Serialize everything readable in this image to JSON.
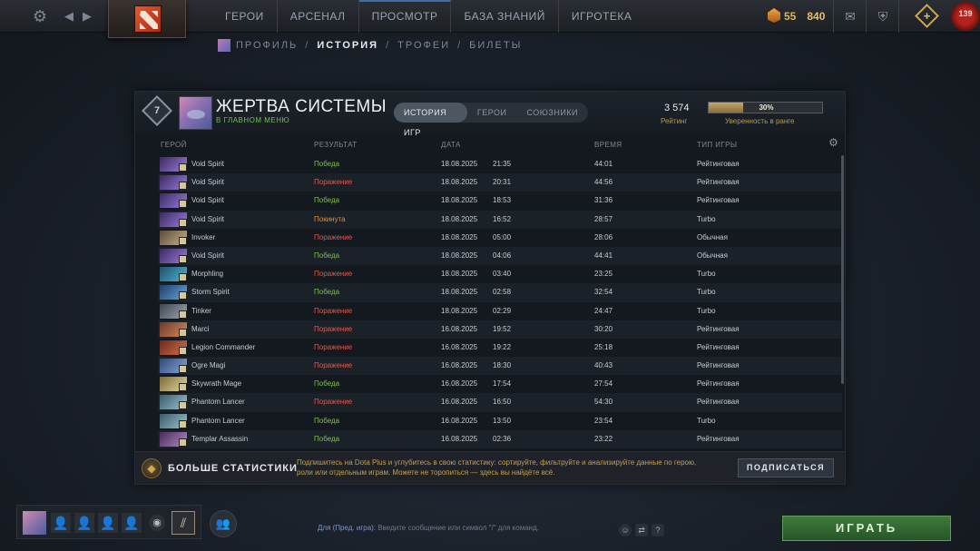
{
  "topbar": {
    "nav": [
      "ГЕРОИ",
      "АРСЕНАЛ",
      "ПРОСМОТР",
      "БАЗА ЗНАНИЙ",
      "ИГРОТЕКА"
    ],
    "gold": "55",
    "shards": "840",
    "notification_count": "139"
  },
  "subnav": {
    "items": [
      "ПРОФИЛЬ",
      "ИСТОРИЯ",
      "ТРОФЕИ",
      "БИЛЕТЫ"
    ],
    "separator": "/"
  },
  "profile": {
    "rank": "7",
    "name": "ЖЕРТВА СИСТЕМЫ",
    "status": "В ГЛАВНОМ МЕНЮ",
    "tabs": [
      "ИСТОРИЯ ИГР",
      "ГЕРОИ",
      "СОЮЗНИКИ"
    ],
    "rating_value": "3 574",
    "rating_label": "Рейтинг",
    "confidence_percent": 30,
    "confidence_text": "30%",
    "confidence_label": "Уверенность в ранге"
  },
  "columns": {
    "hero": "ГЕРОЙ",
    "result": "РЕЗУЛЬТАТ",
    "date": "ДАТА",
    "duration": "ВРЕМЯ",
    "mode": "ТИП ИГРЫ"
  },
  "colors": {
    "win": "#7ec04f",
    "loss": "#e25a48",
    "abandon": "#e48a3a"
  },
  "matches": [
    {
      "hero": "Void Spirit",
      "result": "Победа",
      "status": "win",
      "date": "18.08.2025",
      "time": "21:35",
      "duration": "44:01",
      "mode": "Рейтинговая",
      "portrait": [
        "#3b2a63",
        "#9b7ad8"
      ]
    },
    {
      "hero": "Void Spirit",
      "result": "Поражение",
      "status": "loss",
      "date": "18.08.2025",
      "time": "20:31",
      "duration": "44:56",
      "mode": "Рейтинговая",
      "portrait": [
        "#3b2a63",
        "#9b7ad8"
      ]
    },
    {
      "hero": "Void Spirit",
      "result": "Победа",
      "status": "win",
      "date": "18.08.2025",
      "time": "18:53",
      "duration": "31:36",
      "mode": "Рейтинговая",
      "portrait": [
        "#3b2a63",
        "#9b7ad8"
      ]
    },
    {
      "hero": "Void Spirit",
      "result": "Покинута",
      "status": "abandon",
      "date": "18.08.2025",
      "time": "16:52",
      "duration": "28:57",
      "mode": "Turbo",
      "portrait": [
        "#3b2a63",
        "#9b7ad8"
      ]
    },
    {
      "hero": "Invoker",
      "result": "Поражение",
      "status": "loss",
      "date": "18.08.2025",
      "time": "05:00",
      "duration": "28:06",
      "mode": "Обычная",
      "portrait": [
        "#5b4a3a",
        "#c9b08a"
      ]
    },
    {
      "hero": "Void Spirit",
      "result": "Победа",
      "status": "win",
      "date": "18.08.2025",
      "time": "04:06",
      "duration": "44:41",
      "mode": "Обычная",
      "portrait": [
        "#3b2a63",
        "#9b7ad8"
      ]
    },
    {
      "hero": "Morphling",
      "result": "Поражение",
      "status": "loss",
      "date": "18.08.2025",
      "time": "03:40",
      "duration": "23:25",
      "mode": "Turbo",
      "portrait": [
        "#1f4e6b",
        "#52b6d4"
      ]
    },
    {
      "hero": "Storm Spirit",
      "result": "Победа",
      "status": "win",
      "date": "18.08.2025",
      "time": "02:58",
      "duration": "32:54",
      "mode": "Turbo",
      "portrait": [
        "#1e3f66",
        "#62a8e0"
      ]
    },
    {
      "hero": "Tinker",
      "result": "Поражение",
      "status": "loss",
      "date": "18.08.2025",
      "time": "02:29",
      "duration": "24:47",
      "mode": "Turbo",
      "portrait": [
        "#3c4652",
        "#a0a8b0"
      ]
    },
    {
      "hero": "Marci",
      "result": "Поражение",
      "status": "loss",
      "date": "16.08.2025",
      "time": "19:52",
      "duration": "30:20",
      "mode": "Рейтинговая",
      "portrait": [
        "#6a3a2a",
        "#d88a5a"
      ]
    },
    {
      "hero": "Legion Commander",
      "result": "Поражение",
      "status": "loss",
      "date": "16.08.2025",
      "time": "19:22",
      "duration": "25:18",
      "mode": "Рейтинговая",
      "portrait": [
        "#6b2a1c",
        "#d4704a"
      ]
    },
    {
      "hero": "Ogre Magi",
      "result": "Поражение",
      "status": "loss",
      "date": "16.08.2025",
      "time": "18:30",
      "duration": "40:43",
      "mode": "Рейтинговая",
      "portrait": [
        "#2e4a7a",
        "#8aa6d8"
      ]
    },
    {
      "hero": "Skywrath Mage",
      "result": "Победа",
      "status": "win",
      "date": "16.08.2025",
      "time": "17:54",
      "duration": "27:54",
      "mode": "Рейтинговая",
      "portrait": [
        "#7a6a3a",
        "#e8d89a"
      ]
    },
    {
      "hero": "Phantom Lancer",
      "result": "Поражение",
      "status": "loss",
      "date": "16.08.2025",
      "time": "16:50",
      "duration": "54:30",
      "mode": "Рейтинговая",
      "portrait": [
        "#3a5a6a",
        "#9ac4d0"
      ]
    },
    {
      "hero": "Phantom Lancer",
      "result": "Победа",
      "status": "win",
      "date": "16.08.2025",
      "time": "13:50",
      "duration": "23:54",
      "mode": "Turbo",
      "portrait": [
        "#3a5a6a",
        "#9ac4d0"
      ]
    },
    {
      "hero": "Templar Assassin",
      "result": "Победа",
      "status": "win",
      "date": "16.08.2025",
      "time": "02:36",
      "duration": "23:22",
      "mode": "Рейтинговая",
      "portrait": [
        "#4a2a5a",
        "#b08ac8"
      ]
    }
  ],
  "promo": {
    "title": "БОЛЬШЕ СТАТИСТИКИ",
    "text": "Подпишитесь на Dota Plus и углубитесь в свою статистику: сортируйте, фильтруйте и анализируйте данные по герою, роли или отдельным играм. Можете не торопиться — здесь вы найдёте всё.",
    "button": "ПОДПИСАТЬСЯ"
  },
  "chat": {
    "channel": "Для (Пред. игра):",
    "placeholder": "Введите сообщение или символ \"/\" для команд."
  },
  "play_button": "ИГРАТЬ"
}
